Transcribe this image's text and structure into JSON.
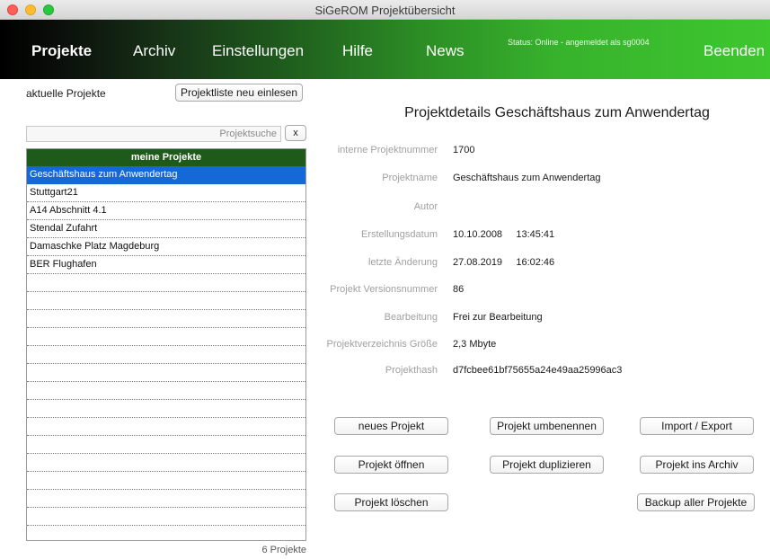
{
  "window": {
    "title": "SiGeROM  Projektübersicht"
  },
  "nav": {
    "items": [
      {
        "label": "Projekte",
        "active": true
      },
      {
        "label": "Archiv"
      },
      {
        "label": "Einstellungen"
      },
      {
        "label": "Hilfe"
      },
      {
        "label": "News"
      }
    ],
    "status": "Status: Online - angemeldet als sg0004",
    "exit_label": "Beenden"
  },
  "left": {
    "heading": "aktuelle Projekte",
    "reload_button": "Projektliste neu einlesen",
    "search_placeholder": "Projektsuche",
    "clear_button": "x",
    "list_header": "meine Projekte",
    "projects": [
      "Geschäftshaus zum Anwendertag",
      "Stuttgart21",
      "A14 Abschnitt 4.1",
      "Stendal Zufahrt",
      "Damaschke Platz Magdeburg",
      "BER Flughafen"
    ],
    "selected_index": 0,
    "count_label": "6 Projekte"
  },
  "details": {
    "title": "Projektdetails Geschäftshaus zum Anwendertag",
    "fields": [
      {
        "label": "interne Projektnummer",
        "value": "1700"
      },
      {
        "label": "Projektname",
        "value": "Geschäftshaus zum Anwendertag"
      },
      {
        "label": "Autor",
        "value": ""
      },
      {
        "label": "Erstellungsdatum",
        "value": "10.10.2008     13:45:41"
      },
      {
        "label": "letzte Änderung",
        "value": "27.08.2019     16:02:46"
      },
      {
        "label": "Projekt Versionsnummer",
        "value": "86"
      },
      {
        "label": "Bearbeitung",
        "value": "Frei zur Bearbeitung"
      },
      {
        "label": "Projektverzeichnis Größe",
        "value": "2,3 Mbyte"
      },
      {
        "label": "Projekthash",
        "value": "d7fcbee61bf75655a24e49aa25996ac3"
      }
    ]
  },
  "actions": {
    "new": "neues Projekt",
    "rename": "Projekt umbenennen",
    "import_export": "Import / Export",
    "open": "Projekt öffnen",
    "duplicate": "Projekt duplizieren",
    "archive": "Projekt ins Archiv",
    "delete": "Projekt löschen",
    "backup": "Backup aller Projekte"
  }
}
